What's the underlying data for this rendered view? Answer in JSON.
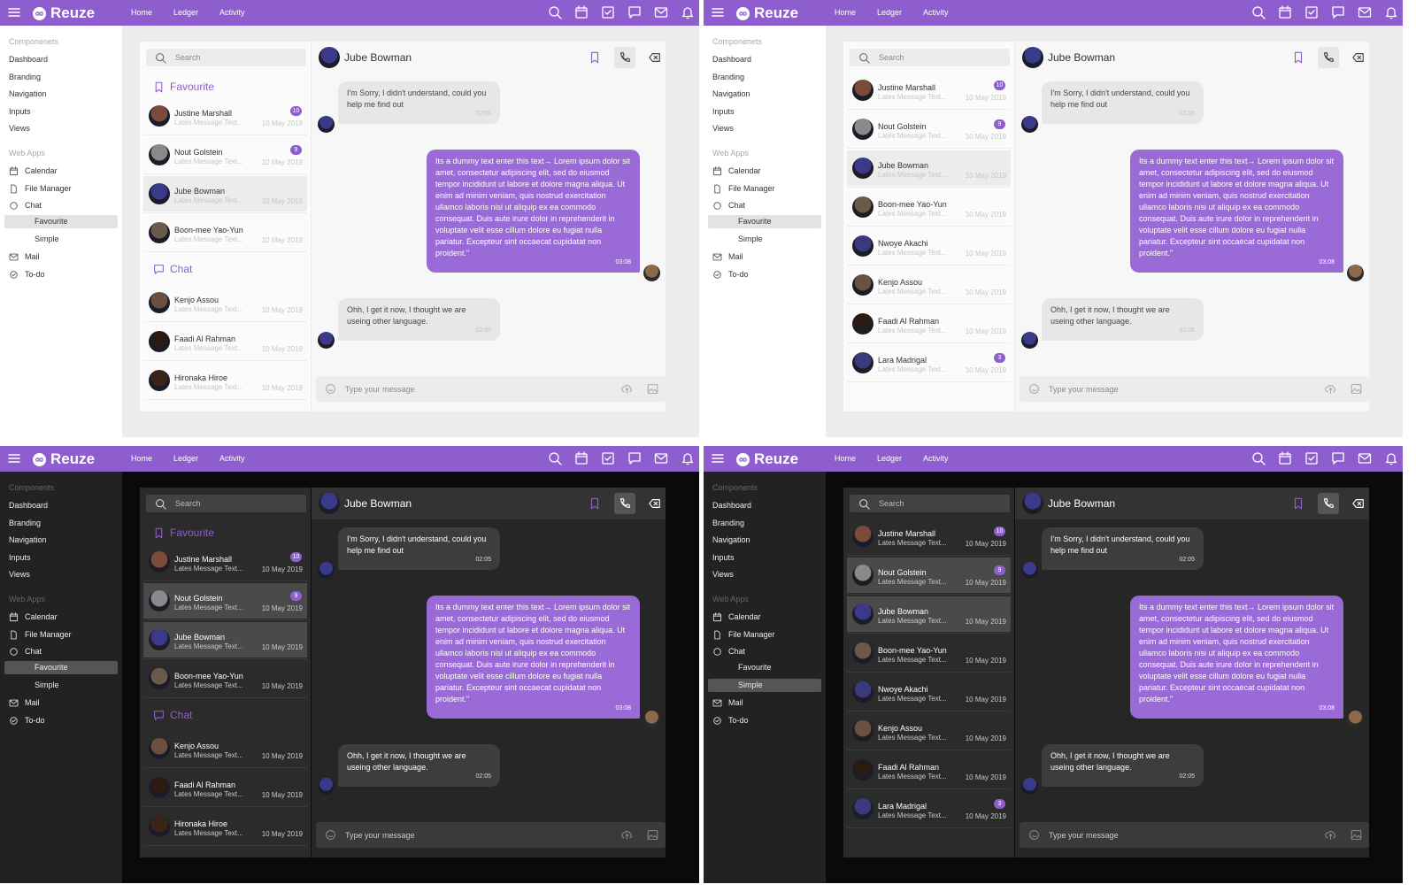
{
  "app": {
    "name": "Reuze",
    "brand_color": "#8f5ece"
  },
  "topnav": [
    "Home",
    "Ledger",
    "Activity"
  ],
  "top_icons": [
    "search-icon",
    "calendar-icon",
    "checkbox-icon",
    "message-icon",
    "mail-icon",
    "bell-icon"
  ],
  "sidebar": {
    "section1": "Componenets",
    "section1_dark": "Components",
    "items1": [
      "Dashboard",
      "Branding",
      "Navigation",
      "Inputs",
      "Views"
    ],
    "section2": "Web Apps",
    "apps": {
      "calendar": "Calendar",
      "file_manager": "File Manager",
      "chat": "Chat",
      "mail": "Mail",
      "todo": "To-do"
    },
    "chat_sub": [
      "Favourite",
      "Simple"
    ]
  },
  "search_placeholder": "Search",
  "favourite_label": "Favourite",
  "chat_label": "Chat",
  "contacts": {
    "justine": {
      "name": "Justine Marshall",
      "preview": "Lates Message Text...",
      "date": "10 May 2019",
      "badge": "10"
    },
    "nout": {
      "name": "Nout Golstein",
      "preview": "Lates Message Text...",
      "date": "10 May 2019",
      "badge": "9"
    },
    "jube": {
      "name": "Jube Bowman",
      "preview": "Lates Message Text...",
      "date": "10 May 2019"
    },
    "boon": {
      "name": "Boon-mee Yao-Yun",
      "preview": "Lates Message Text...",
      "date": "10 May 2019"
    },
    "kenjo": {
      "name": "Kenjo Assou",
      "preview": "Lates Message Text...",
      "date": "10 May 2019"
    },
    "faadi": {
      "name": "Faadi Al Rahman",
      "preview": "Lates Message Text...",
      "date": "10 May 2019"
    },
    "hironaka": {
      "name": "Hironaka Hiroe",
      "preview": "Lates Message Text...",
      "date": "10 May 2019"
    },
    "nwoye": {
      "name": "Nwoye Akachi",
      "preview": "Lates Message Text...",
      "date": "10 May 2019"
    },
    "lara": {
      "name": "Lara Madrigal",
      "preview": "Lates Message Text...",
      "date": "10 May 2019",
      "badge": "3"
    }
  },
  "conversation": {
    "name": "Jube Bowman",
    "messages": [
      {
        "text": "I'm Sorry, I didn't understand, could you help me find out",
        "time": "02:05"
      },
      {
        "text": "Its a dummy text enter this text→ Lorem ipsum dolor sit amet, consectetur adipiscing elit, sed do eiusmod tempor incididunt ut labore et dolore magna aliqua. Ut enim ad minim veniam, quis nostrud exercitation ullamco laboris nisi ut aliquip ex ea commodo consequat. Duis aute irure dolor in reprehenderit in voluptate velit esse cillum dolore eu fugiat nulla pariatur. Excepteur sint occaecat cupidatat non proident.\"",
        "time": "03:08"
      },
      {
        "text": "Ohh, I get it now, I thought we are useing other language.",
        "time": "02:05"
      }
    ],
    "input_placeholder": "Type your message"
  }
}
